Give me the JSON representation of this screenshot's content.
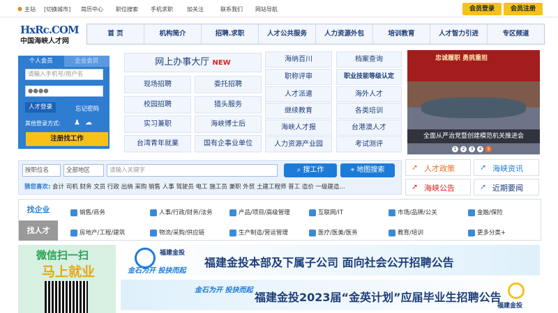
{
  "topbar": {
    "home": "主站",
    "switch_city": "[切换城市]",
    "links": [
      "简历中心",
      "职位搜索",
      "手机求职",
      "加关注",
      "联系我们",
      "网站导航"
    ],
    "member_login": "会员登录",
    "member_register": "会员注册"
  },
  "logo": {
    "en": "HxRc.COM",
    "cn": "中国海峡人才网"
  },
  "nav": [
    "首 页",
    "机构简介",
    "招聘.求职",
    "人才公共服务",
    "人力资源外包",
    "培训教育",
    "人才智力引进",
    "专区频道"
  ],
  "login": {
    "tab_personal": "个人会员",
    "tab_company": "企业会员",
    "user_placeholder": "请输入手机号/用户名",
    "password_mask": "●●●●",
    "login_button": "人才登录",
    "forgot": "忘记密码",
    "other_methods": "其他登录方式:",
    "register_button": "注册找工作"
  },
  "services": {
    "hall": "网上办事大厅",
    "new_badge": "NEW",
    "col1": [
      "现场招聘",
      "校园招聘",
      "实习兼职",
      "台湾青年就業"
    ],
    "col2": [
      "委托招聘",
      "猎头服务",
      "海峡博士后",
      "国有企事业单位"
    ],
    "col3": [
      "海纳百川",
      "职称评审",
      "人才派遣",
      "继续教育",
      "海峡人才报",
      "人力资源产业园"
    ],
    "col4": [
      "档案查询",
      "职业技能等级认定",
      "海外人才",
      "各类培训",
      "台港澳人才",
      "考试测评"
    ]
  },
  "photo": {
    "banner_text": "忠诚履职 勇挑重担",
    "caption": "全面从严治党暨创建模范机关推进会",
    "dots": [
      "1",
      "2",
      "3",
      "4",
      "5"
    ]
  },
  "search": {
    "type": "按职位名",
    "area": "全部地区",
    "keyword_placeholder": "请输入关键字",
    "search_button": "搜工作",
    "map_button": "地图搜索",
    "hot_label": "猜您喜欢:",
    "hot_terms": "会计  司机  财务  文员  行政  出纳  采购  销售  人事  驾驶员  电工  施工员  兼职  外贸  土建工程师  普工  造价  一级建造..."
  },
  "quick_links": [
    "人才政策",
    "海峡资讯",
    "海峡公告",
    "近期要闻"
  ],
  "categories": {
    "tab_company": "找企业",
    "tab_talent": "找人才",
    "row1": [
      "销售/商务",
      "人事/行政/财务/法务",
      "产品/项目/高级管理",
      "互联网/IT",
      "市场/品牌/公关",
      "金融/保险"
    ],
    "row2": [
      "房地产/工程/建筑",
      "物流/采购/供应链",
      "生产制造/营运管理",
      "医疗/医美/医务",
      "教育/培训",
      "更多分类+"
    ]
  },
  "qr": {
    "line1": "微信扫一扫",
    "line2": "马上就业"
  },
  "banners": {
    "b1_logo": "福建金投",
    "b1_slogan": "金石为开 投抉而起",
    "b1_text": "福建金投本部及下属子公司 面向社会公开招聘公告",
    "b2_slogan": "金石为开 投抉而起",
    "b2_text": "福建金投2023届“金英计划”应届毕业生招聘公告",
    "b2_logo": "福建金投",
    "b2_logo_en": "FFIC"
  }
}
